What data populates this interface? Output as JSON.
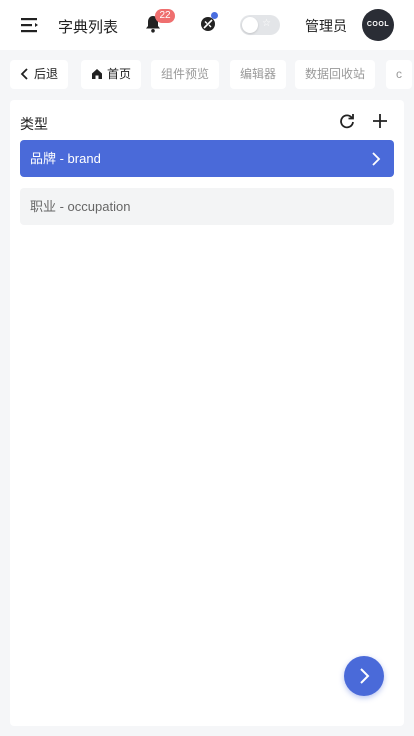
{
  "header": {
    "title": "字典列表",
    "notification_count": "22",
    "theme_toggle_star": "☆",
    "user_name": "管理员",
    "avatar_text": "COOL"
  },
  "tabs": [
    {
      "label": "后退",
      "icon": "chevron-left-icon"
    },
    {
      "label": "首页",
      "icon": "home-icon"
    },
    {
      "label": "组件预览"
    },
    {
      "label": "编辑器"
    },
    {
      "label": "数据回收站"
    },
    {
      "label": "c"
    }
  ],
  "panel": {
    "title": "类型",
    "items": [
      {
        "label": "品牌 - brand",
        "active": true
      },
      {
        "label": "职业 - occupation",
        "active": false
      }
    ]
  },
  "colors": {
    "primary": "#4a6ad9",
    "badge": "#ef6f6f"
  },
  "icons": [
    "menu-icon",
    "bell-icon",
    "theme-icon",
    "refresh-icon",
    "add-icon",
    "chevron-right-icon"
  ]
}
